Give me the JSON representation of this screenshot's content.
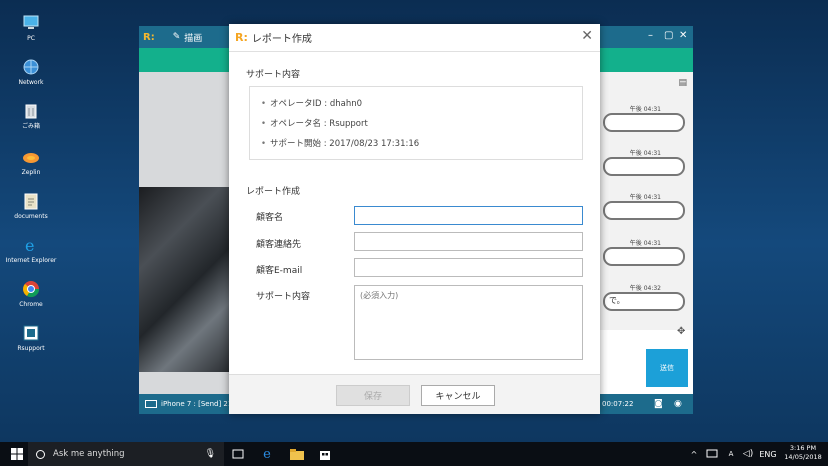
{
  "desktop": {
    "icons": [
      {
        "label": "PC",
        "icon": "pc-icon"
      },
      {
        "label": "Network",
        "icon": "network-icon"
      },
      {
        "label": "ごみ箱",
        "icon": "recycle-bin-icon"
      },
      {
        "label": "Zeplin",
        "icon": "zeplin-icon"
      },
      {
        "label": "documents",
        "icon": "folder-icon"
      },
      {
        "label": "Internet Explorer",
        "icon": "ie-icon"
      },
      {
        "label": "Chrome",
        "icon": "chrome-icon"
      },
      {
        "label": "Rsupport",
        "icon": "rsupport-icon"
      }
    ]
  },
  "app": {
    "logo": "R:",
    "draw_label": "描画",
    "chat_times": [
      "午後 04:31",
      "午後 04:31",
      "午後 04:31",
      "午後 04:31",
      "午後 04:32"
    ],
    "chat_last_text": "で。",
    "send_label": "送信",
    "status_text": "iPhone 7 : [Send] 21.",
    "timer": "00:07:22"
  },
  "dialog": {
    "logo": "R:",
    "title": "レポート作成",
    "section_support": "サポート内容",
    "info": [
      "オペレータID : dhahn0",
      "オペレータ名 : Rsupport",
      "サポート開始 : 2017/08/23 17:31:16"
    ],
    "section_report": "レポート作成",
    "fields": {
      "customer_name": {
        "label": "顧客名",
        "value": ""
      },
      "customer_contact": {
        "label": "顧客連絡先",
        "value": ""
      },
      "customer_email": {
        "label": "顧客E-mail",
        "value": ""
      },
      "support_content": {
        "label": "サポート内容",
        "placeholder": "(必須入力)"
      }
    },
    "save_label": "保存",
    "cancel_label": "キャンセル"
  },
  "taskbar": {
    "search_placeholder": "Ask me anything",
    "time": "3:16 PM",
    "date": "14/05/2018"
  },
  "colors": {
    "app_titlebar": "#1d6b8c",
    "app_green": "#13b08c",
    "send_button": "#1ca0d8",
    "accent_orange": "#f5a623"
  }
}
